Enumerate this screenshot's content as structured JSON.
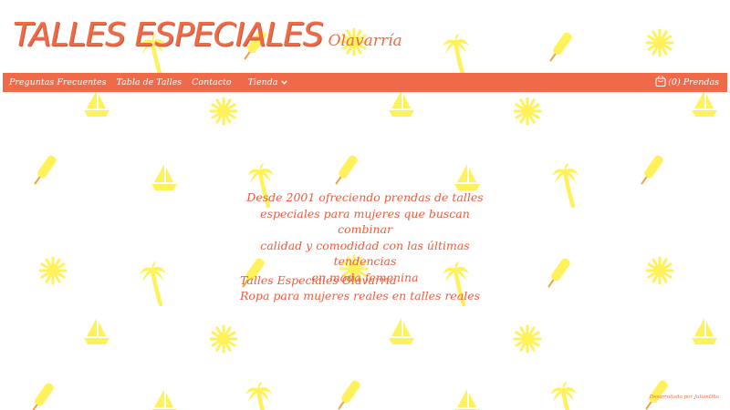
{
  "brand": {
    "title": "TALLES ESPECIALES",
    "subtitle": "Olavarría"
  },
  "nav": {
    "items": [
      "Preguntas Frecuentes",
      "Tabla de Talles",
      "Contacto"
    ],
    "dropdown_label": "Tienda",
    "cart_label": "(0) Prendas"
  },
  "intro": {
    "lines": [
      "Desde 2001 ofreciendo prendas de talles",
      "especiales para mujeres que buscan combinar",
      "calidad y comodidad con las últimas tendencias",
      "en moda femenina"
    ]
  },
  "tagline": {
    "line1": "Talles Especiales Olavarria",
    "line2": "Ropa para mujeres reales en talles reales"
  },
  "footer": {
    "credit": "Desarrollado por JulianDba"
  },
  "colors": {
    "accent": "#ee6a48",
    "pattern": "#fff15a",
    "pattern_stroke": "#f0a23c"
  },
  "icons": {
    "pattern": [
      "popsicle-icon",
      "sun-icon",
      "palm-tree-icon",
      "sailboat-icon"
    ],
    "cart": "cart-icon",
    "dropdown": "chevron-down-icon"
  }
}
